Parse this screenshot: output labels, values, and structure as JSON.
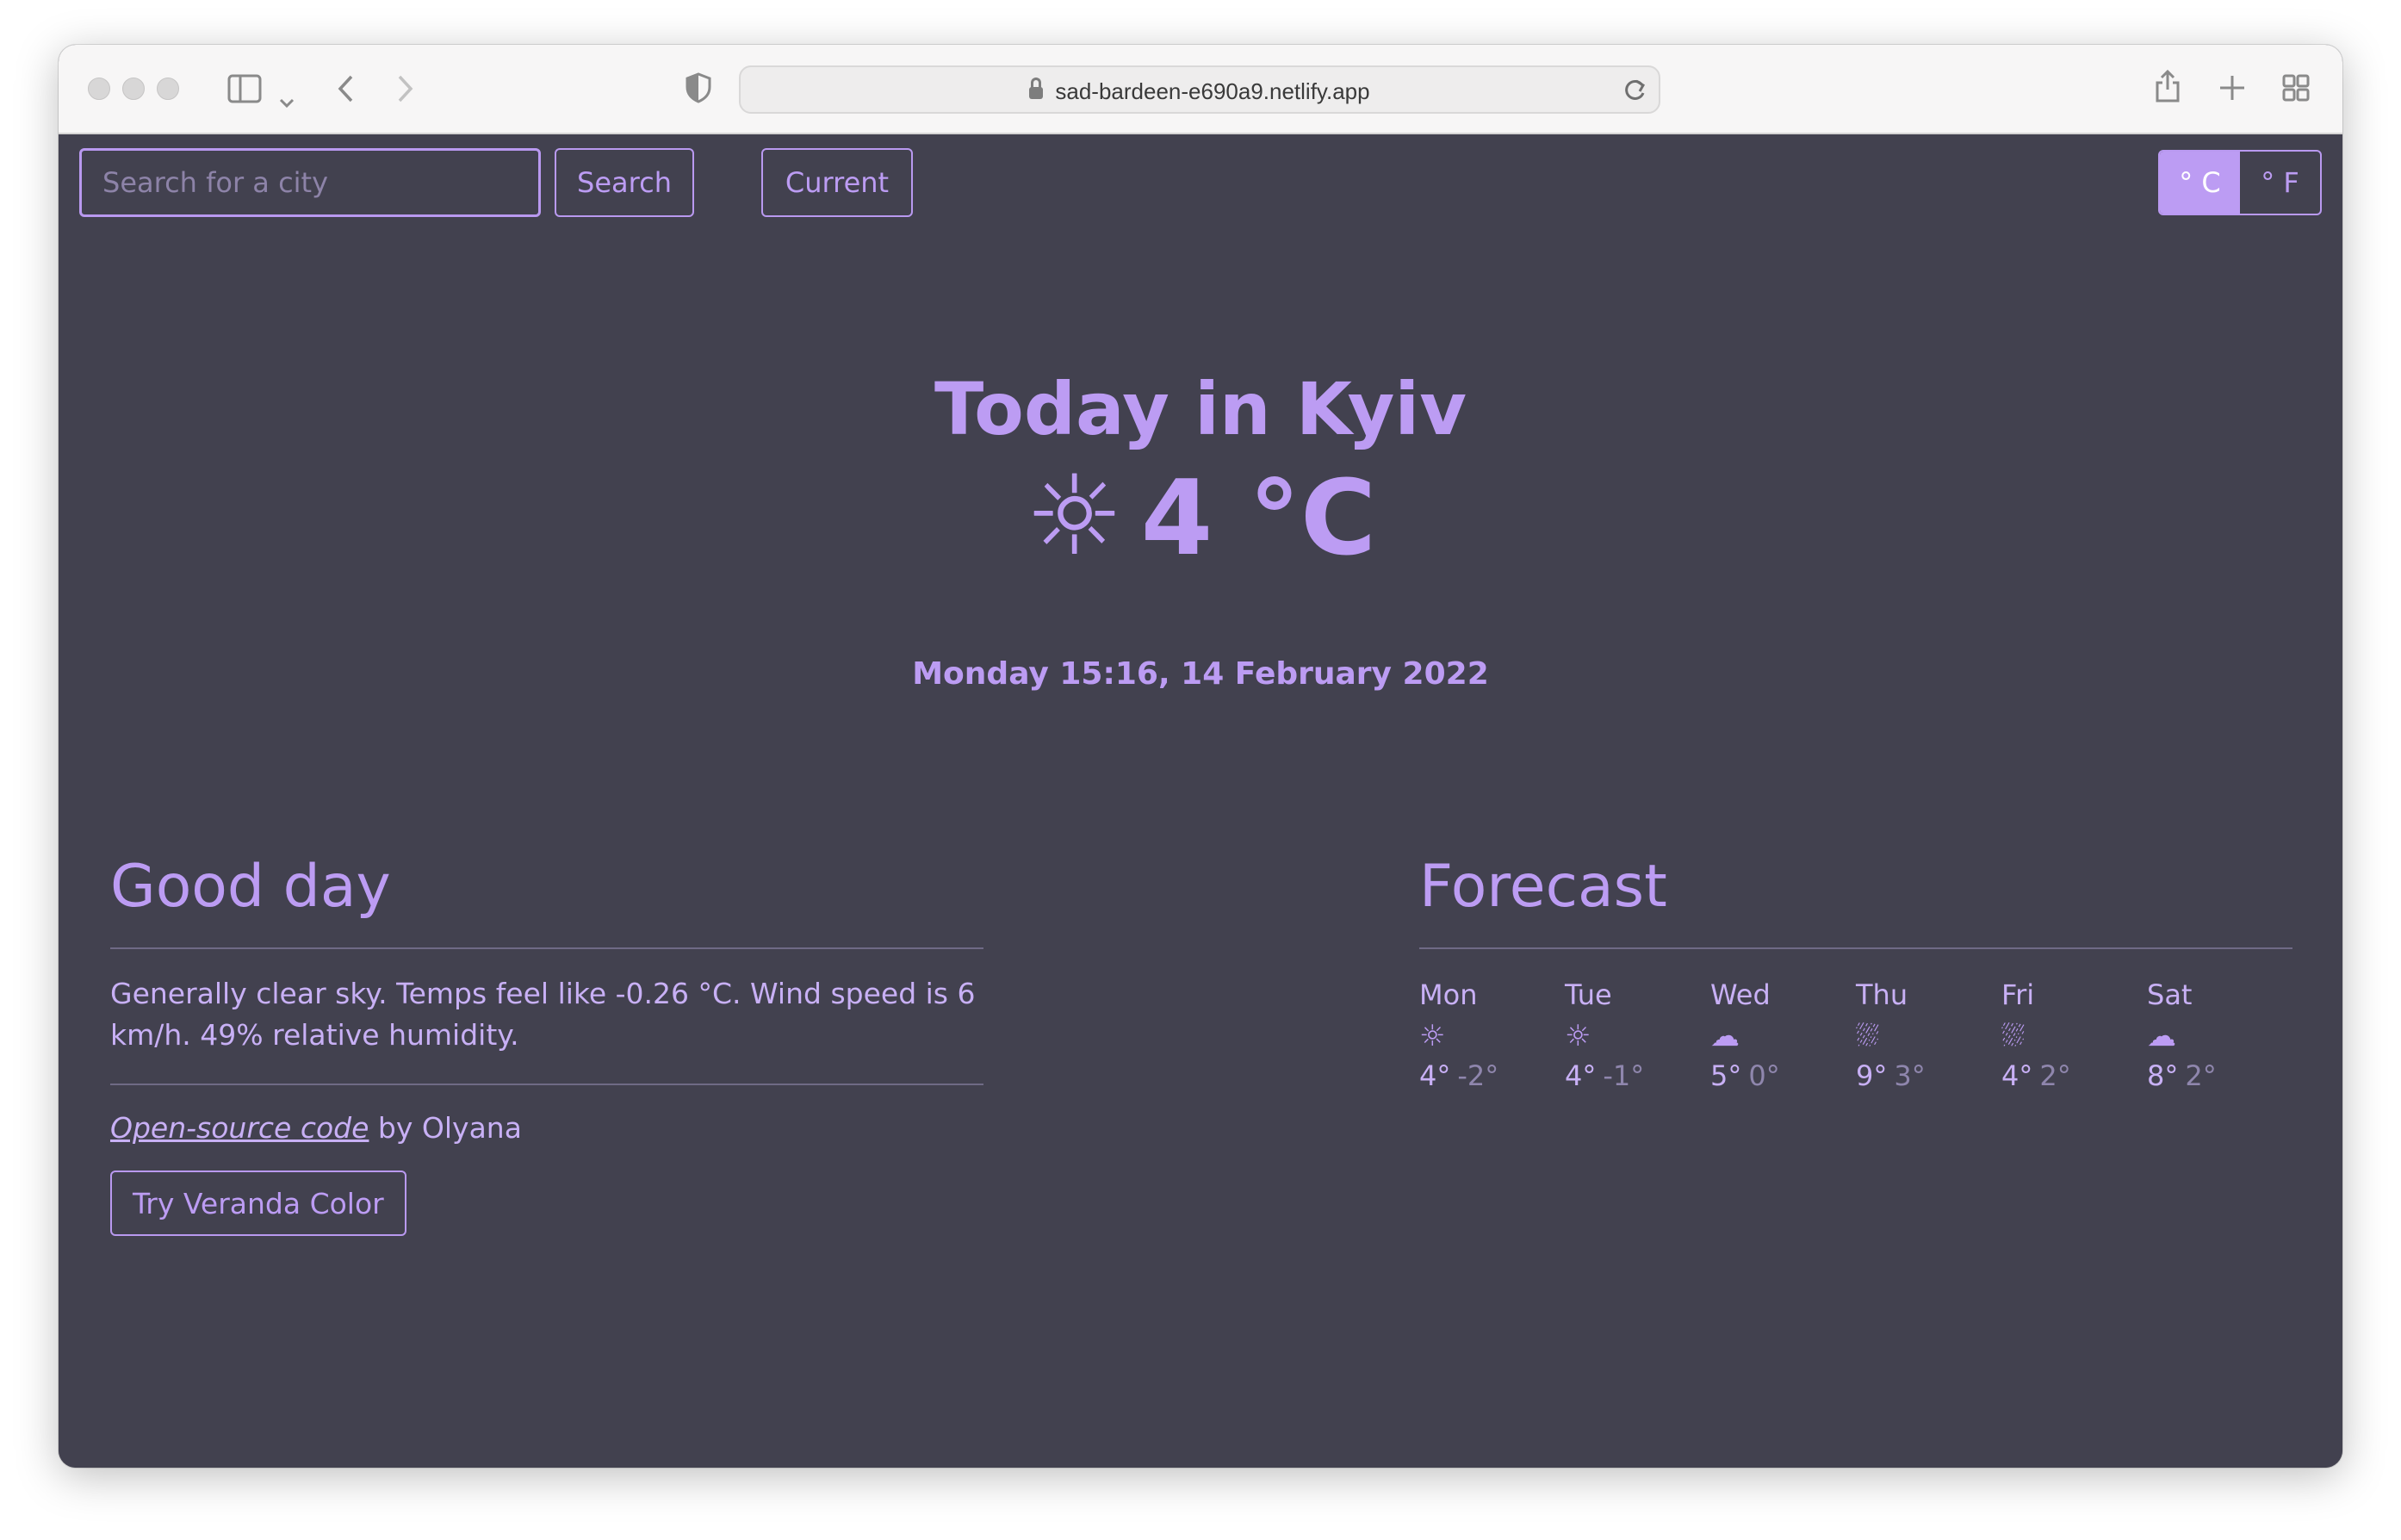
{
  "browser": {
    "url": "sad-bardeen-e690a9.netlify.app"
  },
  "search": {
    "placeholder": "Search for a city",
    "button_label": "Search"
  },
  "current_button_label": "Current",
  "units": {
    "celsius_label": "° C",
    "fahrenheit_label": "° F",
    "active": "celsius"
  },
  "hero": {
    "title": "Today in Kyiv",
    "temperature": "4 °C",
    "icon": "☼",
    "date": "Monday 15:16, 14 February 2022"
  },
  "summary": {
    "title": "Good day",
    "description": "Generally clear sky. Temps feel like -0.26 °C. Wind speed is 6 km/h. 49% relative humidity.",
    "credit_link": "Open-source code",
    "credit_text": " by Olyana",
    "veranda_button": "Try Veranda Color"
  },
  "forecast": {
    "title": "Forecast",
    "days": [
      {
        "name": "Mon",
        "icon": "☼",
        "icon_name": "sun-icon",
        "high": "4°",
        "low": "-2°"
      },
      {
        "name": "Tue",
        "icon": "☼",
        "icon_name": "sun-icon",
        "high": "4°",
        "low": "-1°"
      },
      {
        "name": "Wed",
        "icon": "☁",
        "icon_name": "cloud-snow-icon",
        "high": "5°",
        "low": "0°"
      },
      {
        "name": "Thu",
        "icon": "⛆",
        "icon_name": "sun-cloud-rain-icon",
        "high": "9°",
        "low": "3°"
      },
      {
        "name": "Fri",
        "icon": "⛆",
        "icon_name": "sun-cloud-rain-icon",
        "high": "4°",
        "low": "2°"
      },
      {
        "name": "Sat",
        "icon": "☁",
        "icon_name": "cloud-snow-icon",
        "high": "8°",
        "low": "2°"
      }
    ]
  },
  "colors": {
    "background": "#42414f",
    "accent": "#bc9cf3"
  }
}
